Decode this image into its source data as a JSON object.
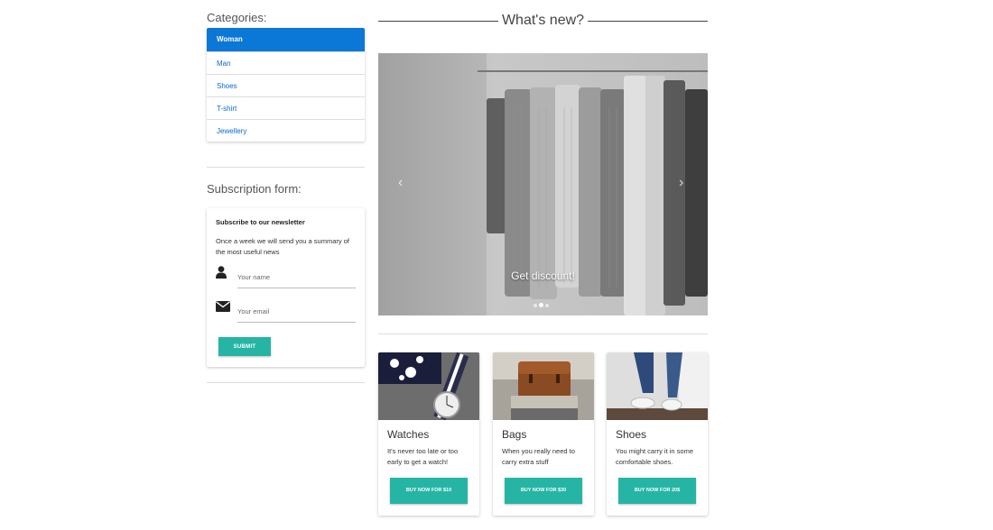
{
  "categories": {
    "title": "Categories:",
    "items": [
      {
        "label": "Woman"
      },
      {
        "label": "Man"
      },
      {
        "label": "Shoes"
      },
      {
        "label": "T-shirt"
      },
      {
        "label": "Jewellery"
      }
    ],
    "active": "Woman"
  },
  "subscription": {
    "title": "Subscription form:",
    "heading": "Subscribe to our newsletter",
    "description": "Once a week we will send you a summary of the most useful news",
    "name_placeholder": "Your name",
    "email_placeholder": "Your email",
    "submit_label": "SUBMIT",
    "icons": {
      "name": "user-icon",
      "email": "envelope-icon"
    }
  },
  "whats_new": {
    "title": "What's new?"
  },
  "carousel": {
    "caption": "Get discount!",
    "prev_icon": "chevron-left-icon",
    "next_icon": "chevron-right-icon",
    "slide_count": 3,
    "active_slide": 1
  },
  "products": [
    {
      "name": "Watches",
      "description": "It's never too late or too early to get a watch!",
      "button": "BUY NOW FOR $10"
    },
    {
      "name": "Bags",
      "description": "When you really need to carry extra stuff",
      "button": "BUY NOW FOR $30"
    },
    {
      "name": "Shoes",
      "description": "You might carry it in some comfortable shoes.",
      "button": "BUY NOW FOR 20$"
    }
  ],
  "colors": {
    "accent_blue": "#0b77d6",
    "accent_teal": "#26b5a5",
    "link_blue": "#0a6bd0"
  }
}
